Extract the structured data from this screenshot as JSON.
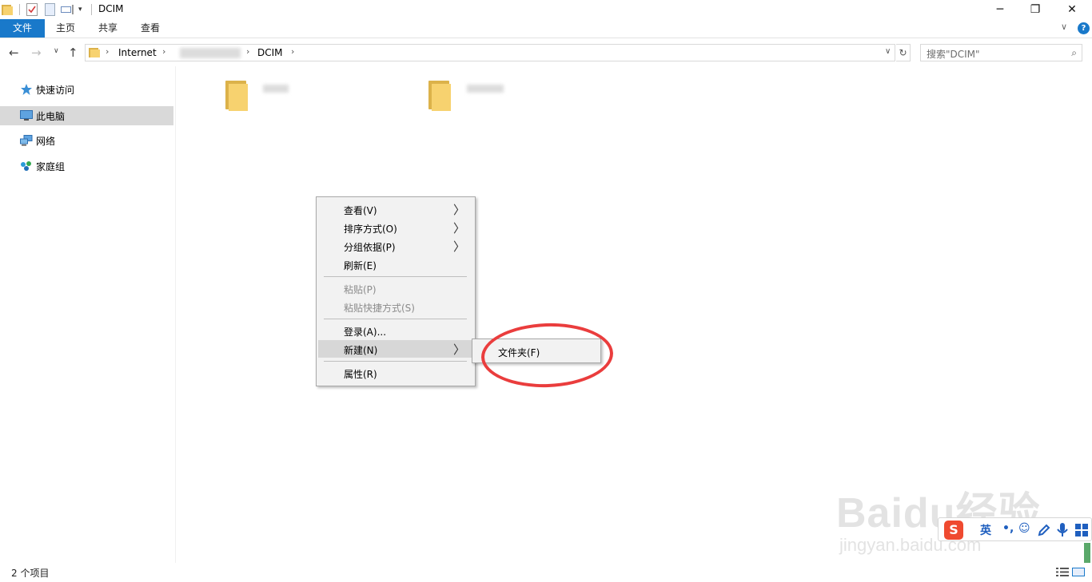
{
  "window": {
    "title": "DCIM",
    "minimize": "─",
    "restore": "❐",
    "close": "✕"
  },
  "ribbon": {
    "tabs": [
      "文件",
      "主页",
      "共享",
      "查看"
    ],
    "help": "?",
    "collapse": "∨"
  },
  "address": {
    "segments": [
      "Internet",
      "DCIM"
    ],
    "search_placeholder": "搜索\"DCIM\""
  },
  "nav": {
    "items": [
      {
        "label": "快速访问",
        "icon": "star-icon"
      },
      {
        "label": "此电脑",
        "icon": "computer-icon",
        "selected": true
      },
      {
        "label": "网络",
        "icon": "network-icon"
      },
      {
        "label": "家庭组",
        "icon": "homegroup-icon"
      }
    ]
  },
  "context_menu": {
    "items": [
      {
        "label": "查看(V)",
        "submenu": true
      },
      {
        "label": "排序方式(O)",
        "submenu": true
      },
      {
        "label": "分组依据(P)",
        "submenu": true
      },
      {
        "label": "刷新(E)"
      },
      {
        "label": "粘贴(P)",
        "disabled": true
      },
      {
        "label": "粘贴快捷方式(S)",
        "disabled": true
      },
      {
        "label": "登录(A)..."
      },
      {
        "label": "新建(N)",
        "submenu": true,
        "highlighted": true
      },
      {
        "label": "属性(R)"
      }
    ],
    "submenu_arrow": "〉",
    "new_submenu": {
      "label": "文件夹(F)"
    }
  },
  "status": {
    "item_count": "2 个项目"
  },
  "watermark": {
    "brand": "Baidu经验",
    "url": "jingyan.baidu.com"
  },
  "ime": {
    "logo": "S",
    "mode": "英",
    "punct": "•,"
  },
  "colors": {
    "accent": "#1979ca",
    "folder": "#f7d26f",
    "annotation": "#ea3d3d"
  }
}
